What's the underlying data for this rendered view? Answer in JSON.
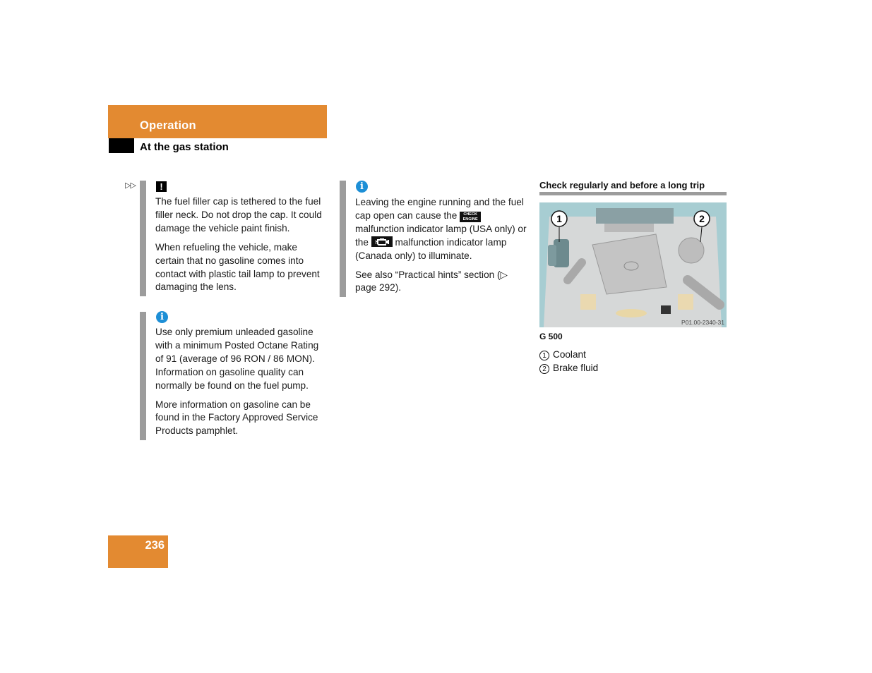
{
  "header": {
    "section": "Operation",
    "subsection": "At the gas station",
    "accent_color": "#e38a31"
  },
  "continuation_marker": "▷▷",
  "column1": {
    "warning_note": {
      "icon": "warning-icon",
      "icon_glyph": "!",
      "paragraphs": [
        "The fuel filler cap is tethered to the fuel filler neck. Do not drop the cap. It could damage the vehicle paint finish.",
        "When refueling the vehicle, make certain that no gasoline comes into contact with plastic tail lamp to prevent damaging the lens."
      ]
    },
    "info_note": {
      "icon": "info-icon",
      "icon_glyph": "i",
      "paragraphs": [
        "Use only premium unleaded gasoline with a minimum Posted Octane Rating of 91 (average of 96 RON / 86 MON). Information on gasoline quality can normally be found on the fuel pump.",
        "More information on gasoline can be found in the Factory Approved Service Products pamphlet."
      ]
    }
  },
  "column2": {
    "info_note": {
      "icon": "info-icon",
      "icon_glyph": "i",
      "p1_part1": "Leaving the engine running and the fuel cap open can cause the ",
      "check_engine_label_top": "CHECK",
      "check_engine_label_bottom": "ENGINE",
      "p1_part2": " malfunction indicator lamp (USA only) or the ",
      "p1_part3": " malfunction indicator lamp (Canada only) to illuminate.",
      "p2": "See also “Practical hints” section (▷ page 292)."
    }
  },
  "column3": {
    "heading": "Check regularly and before a long trip",
    "image": {
      "description": "Engine compartment illustration",
      "reference_code": "P01.00-2340-31",
      "callouts": [
        "1",
        "2"
      ]
    },
    "caption": "G 500",
    "legend": [
      {
        "num": "1",
        "label": "Coolant"
      },
      {
        "num": "2",
        "label": "Brake fluid"
      }
    ]
  },
  "footer": {
    "page_number": "236"
  }
}
